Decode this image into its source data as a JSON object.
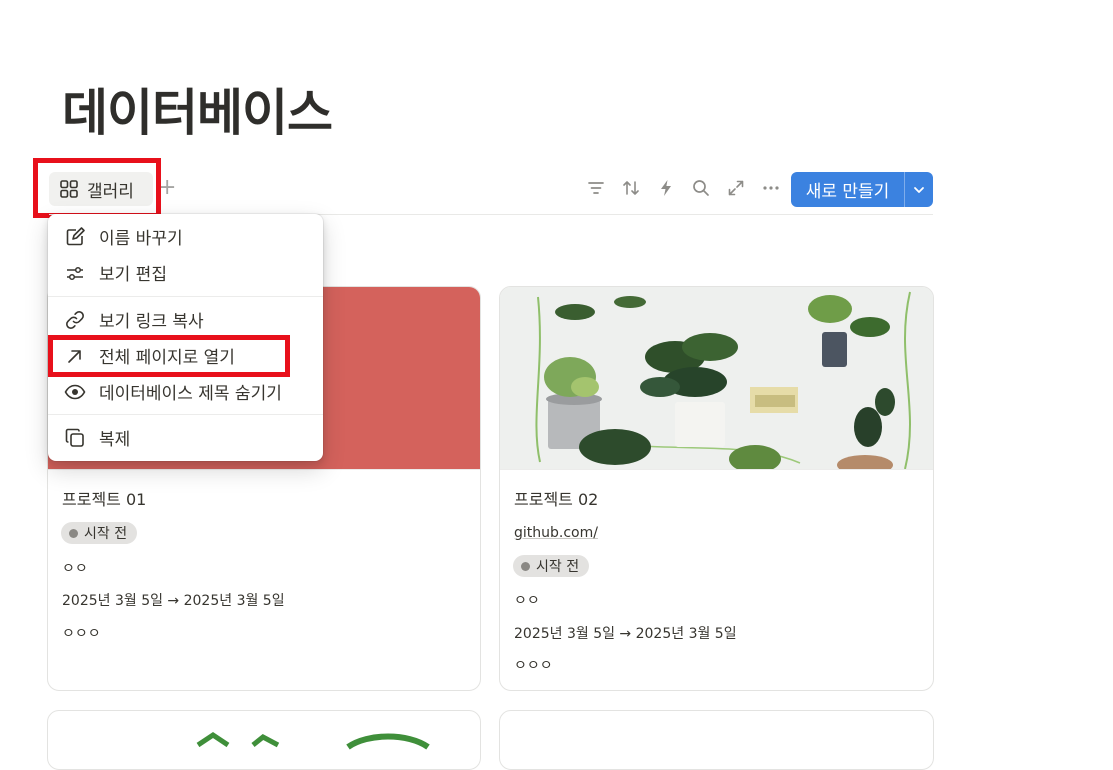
{
  "page": {
    "title": "데이터베이스"
  },
  "toolbar": {
    "view_tab_label": "갤러리",
    "add_view": "+",
    "new_button_label": "새로 만들기"
  },
  "menu": {
    "items": [
      {
        "label": "이름 바꾸기",
        "icon": "edit-icon"
      },
      {
        "label": "보기 편집",
        "icon": "sliders-icon"
      },
      {
        "label": "보기 링크 복사",
        "icon": "link-icon"
      },
      {
        "label": "전체 페이지로 열기",
        "icon": "arrow-up-right-icon"
      },
      {
        "label": "데이터베이스 제목 숨기기",
        "icon": "eye-icon"
      },
      {
        "label": "복제",
        "icon": "duplicate-icon"
      }
    ]
  },
  "cards": [
    {
      "title": "프로젝트 01",
      "status": "시작 전",
      "field1": "ㅇㅇ",
      "dates": "2025년 3월 5일 → 2025년 3월 5일",
      "field2": "ㅇㅇㅇ",
      "cover_color": "#d4625c"
    },
    {
      "title": "프로젝트 02",
      "link": "github.com/",
      "status": "시작 전",
      "field1": "ㅇㅇ",
      "dates": "2025년 3월 5일 → 2025년 3월 5일",
      "field2": "ㅇㅇㅇ"
    }
  ],
  "colors": {
    "accent": "#3b82e0",
    "highlight": "#e8101b",
    "status_dot": "#8a8884"
  }
}
